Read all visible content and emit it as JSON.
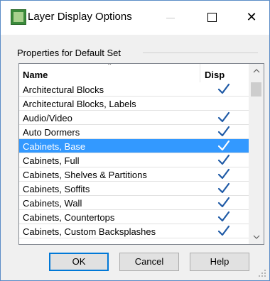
{
  "window": {
    "title": "Layer Display Options",
    "app_icon": "chief-architect-app-icon"
  },
  "titlebar": {
    "minimize_icon": "minimize-icon",
    "maximize_icon": "maximize-icon",
    "close_symbol": "✕"
  },
  "group": {
    "label": "Properties for Default Set"
  },
  "list": {
    "columns": {
      "name": "Name",
      "disp": "Disp"
    },
    "sort_indicator": "⌃",
    "check_icon": "checkmark-icon",
    "colors": {
      "selected_bg": "#3399ff",
      "check": "#1f5aa6"
    },
    "rows": [
      {
        "name": "Architectural Blocks",
        "checked": true,
        "selected": false
      },
      {
        "name": "Architectural Blocks, Labels",
        "checked": false,
        "selected": false
      },
      {
        "name": "Audio/Video",
        "checked": true,
        "selected": false
      },
      {
        "name": "Auto Dormers",
        "checked": true,
        "selected": false
      },
      {
        "name": "Cabinets,  Base",
        "checked": true,
        "selected": true
      },
      {
        "name": "Cabinets,  Full",
        "checked": true,
        "selected": false
      },
      {
        "name": "Cabinets,  Shelves & Partitions",
        "checked": true,
        "selected": false
      },
      {
        "name": "Cabinets,  Soffits",
        "checked": true,
        "selected": false
      },
      {
        "name": "Cabinets,  Wall",
        "checked": true,
        "selected": false
      },
      {
        "name": "Cabinets, Countertops",
        "checked": true,
        "selected": false
      },
      {
        "name": "Cabinets, Custom Backsplashes",
        "checked": true,
        "selected": false
      }
    ],
    "scroll_up": "▲",
    "scroll_down": "▼"
  },
  "buttons": {
    "ok": "OK",
    "cancel": "Cancel",
    "help": "Help"
  }
}
